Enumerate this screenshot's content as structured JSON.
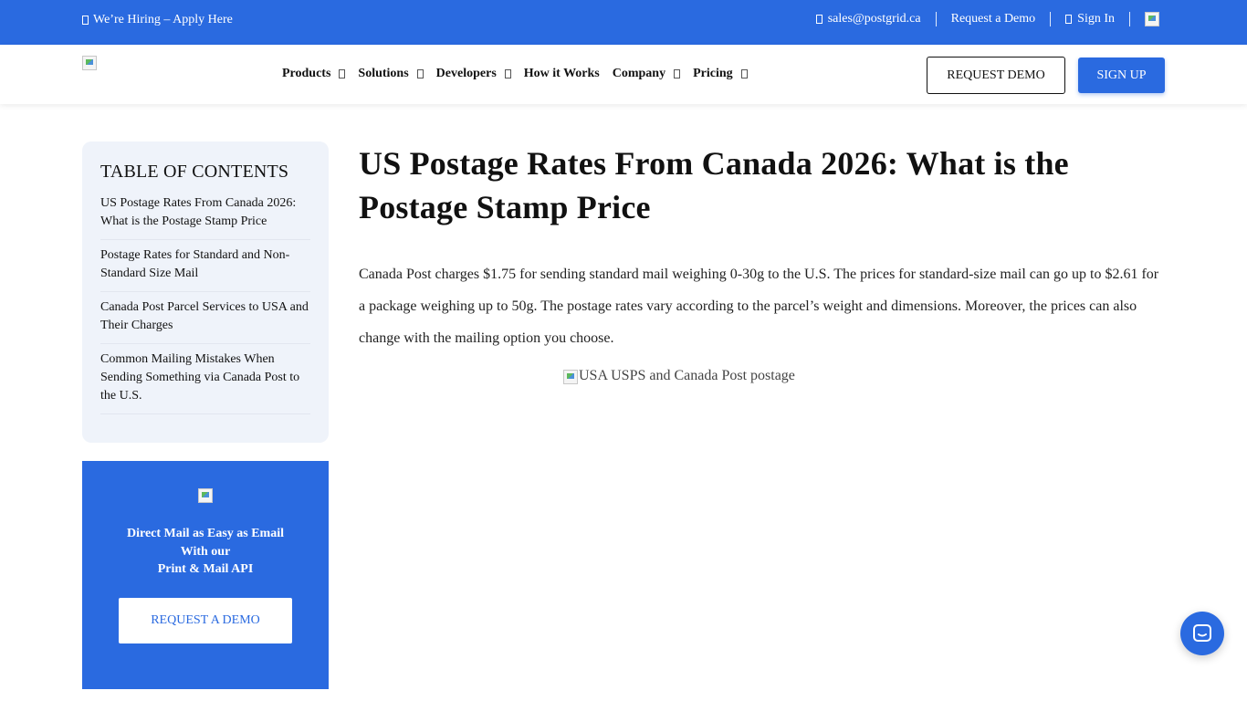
{
  "topbar": {
    "hiring": "We’re Hiring – Apply Here",
    "email": "sales@postgrid.ca",
    "request_demo": "Request a Demo",
    "sign_in": "Sign In"
  },
  "nav": {
    "items": [
      {
        "label": "Products",
        "dropdown": true
      },
      {
        "label": "Solutions",
        "dropdown": true
      },
      {
        "label": "Developers",
        "dropdown": true
      },
      {
        "label": "How it Works",
        "dropdown": false
      },
      {
        "label": "Company",
        "dropdown": true
      },
      {
        "label": "Pricing",
        "dropdown": true
      }
    ],
    "request_demo_button": "REQUEST DEMO",
    "sign_up_button": "SIGN UP"
  },
  "toc": {
    "title": "TABLE OF CONTENTS",
    "items": [
      "US Postage Rates From Canada 2026: What is the Postage Stamp Price",
      "Postage Rates for Standard and Non-Standard Size Mail",
      "Canada Post Parcel Services to USA and Their Charges",
      "Common Mailing Mistakes When Sending Something via Canada Post to the U.S."
    ]
  },
  "cta": {
    "line1": "Direct Mail as Easy as Email",
    "line2": "With our",
    "line3": "Print & Mail API",
    "button": "REQUEST A DEMO"
  },
  "article": {
    "title": "US Postage Rates From Canada 2026: What is the Postage Stamp Price",
    "intro": "Canada Post charges $1.75 for sending standard mail weighing 0-30g to the U.S. The prices for standard-size mail can go up to $2.61 for a package weighing up to 50g. The postage rates vary according to the parcel’s weight and dimensions. Moreover, the prices can also change with the mailing option you choose.",
    "image_alt": "USA USPS and Canada Post postage"
  },
  "colors": {
    "brand_blue": "#2a6ae0",
    "toc_background": "#eff3fa"
  },
  "icons": {
    "hiring": "briefcase-icon",
    "email": "envelope-icon",
    "sign_in": "user-icon",
    "flag": "canada-flag-icon",
    "chat": "chat-bubble-icon"
  }
}
